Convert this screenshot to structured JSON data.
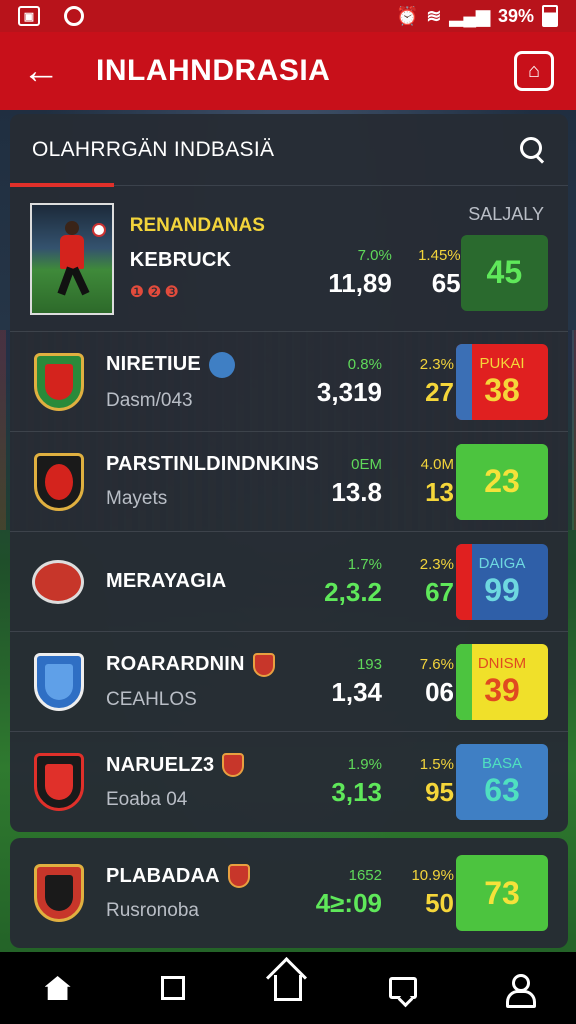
{
  "status_bar": {
    "right_text": "39%"
  },
  "app_bar": {
    "title": "INLAHNDRASIA"
  },
  "section": {
    "title": "OLAHRRGÄN INDBASIÄ",
    "rank_label": "SALJALY"
  },
  "featured": {
    "league": "RENANDANAS",
    "name": "KEBRUCK",
    "dots": "❶❷❸",
    "stat1_pct": "7.0%",
    "stat1_val": "11,89",
    "stat2_pct": "1.45%",
    "stat2_val": "65",
    "score": "45",
    "score_color": "#2a6a2e",
    "score_text_color": "#5fe85a"
  },
  "rows": [
    {
      "name": "NIRETIUE",
      "sub": "Dasm/043",
      "stat1_pct": "0.8%",
      "stat1_val": "3,319",
      "stat2_pct": "2.3%",
      "stat2_val": "27",
      "score_label": "PUKAI",
      "score": "38",
      "score_color": "#e02020",
      "score_text_color": "#f5d63a",
      "stripe_color": "#3b6fb5"
    },
    {
      "name": "PARSTINLDINDNKINS",
      "sub": "Mayets",
      "stat1_pct": "0EM",
      "stat1_val": "13.8",
      "stat2_pct": "4.0M",
      "stat2_val": "13",
      "score_label": "",
      "score": "23",
      "score_color": "#4cc43f",
      "score_text_color": "#f5e23a",
      "stripe_color": "#4cc43f"
    },
    {
      "name": "MERAYAGIA",
      "sub": "",
      "stat1_pct": "1.7%",
      "stat1_val": "2,3.2",
      "stat2_pct": "2.3%",
      "stat2_val": "67",
      "score_label": "DAIGA",
      "score": "99",
      "score_color": "#2f5fa8",
      "score_text_color": "#6ed8e0",
      "stripe_color": "#e02020"
    },
    {
      "name": "ROARARDNIN",
      "sub": "CEAHLOS",
      "stat1_pct": "193",
      "stat1_val": "1,34",
      "stat2_pct": "7.6%",
      "stat2_val": "06",
      "score_label": "DNISM",
      "score": "39",
      "score_color": "#f0e02a",
      "score_text_color": "#e04a20",
      "stripe_color": "#4cc43f"
    },
    {
      "name": "NARUELZ3",
      "sub": "Eoaba 04",
      "stat1_pct": "1.9%",
      "stat1_val": "3,13",
      "stat2_pct": "1.5%",
      "stat2_val": "95",
      "score_label": "BASA",
      "score": "63",
      "score_color": "#3f7fc4",
      "score_text_color": "#4fe0c0",
      "stripe_color": "#3f7fc4"
    }
  ],
  "extra_row": {
    "name": "PLABADAA",
    "sub": "Rusronoba",
    "stat1_pct": "1652",
    "stat1_val": "4≥:09",
    "stat2_pct": "10.9%",
    "stat2_val": "50",
    "score": "73",
    "score_color": "#4cc43f",
    "score_text_color": "#f5e23a"
  }
}
